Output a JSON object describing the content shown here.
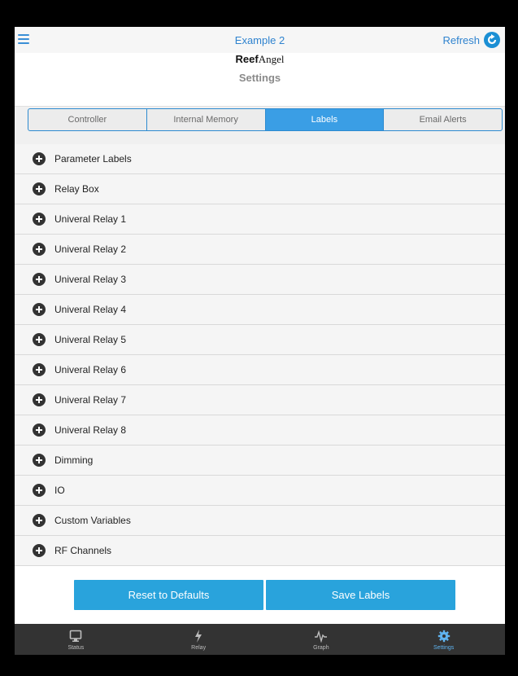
{
  "header": {
    "title": "Example 2",
    "refresh_label": "Refresh"
  },
  "logo": {
    "reef": "Reef",
    "angel": "Angel"
  },
  "page_title": "Settings",
  "tabs": [
    {
      "label": "Controller",
      "active": false
    },
    {
      "label": "Internal Memory",
      "active": false
    },
    {
      "label": "Labels",
      "active": true
    },
    {
      "label": "Email Alerts",
      "active": false
    }
  ],
  "list_items": [
    {
      "label": "Parameter Labels"
    },
    {
      "label": "Relay Box"
    },
    {
      "label": "Univeral Relay 1"
    },
    {
      "label": "Univeral Relay 2"
    },
    {
      "label": "Univeral Relay 3"
    },
    {
      "label": "Univeral Relay 4"
    },
    {
      "label": "Univeral Relay 5"
    },
    {
      "label": "Univeral Relay 6"
    },
    {
      "label": "Univeral Relay 7"
    },
    {
      "label": "Univeral Relay 8"
    },
    {
      "label": "Dimming"
    },
    {
      "label": "IO"
    },
    {
      "label": "Custom Variables"
    },
    {
      "label": "RF Channels"
    }
  ],
  "actions": {
    "reset_label": "Reset to Defaults",
    "save_label": "Save Labels"
  },
  "nav": [
    {
      "label": "Status",
      "icon": "monitor-icon",
      "active": false
    },
    {
      "label": "Relay",
      "icon": "lightning-icon",
      "active": false
    },
    {
      "label": "Graph",
      "icon": "pulse-icon",
      "active": false
    },
    {
      "label": "Settings",
      "icon": "gear-icon",
      "active": true
    }
  ],
  "colors": {
    "accent": "#2f83cf",
    "tab_active": "#3a9ee5",
    "button": "#29a3dc",
    "navbar": "#333333",
    "nav_active": "#5fb3ef"
  }
}
